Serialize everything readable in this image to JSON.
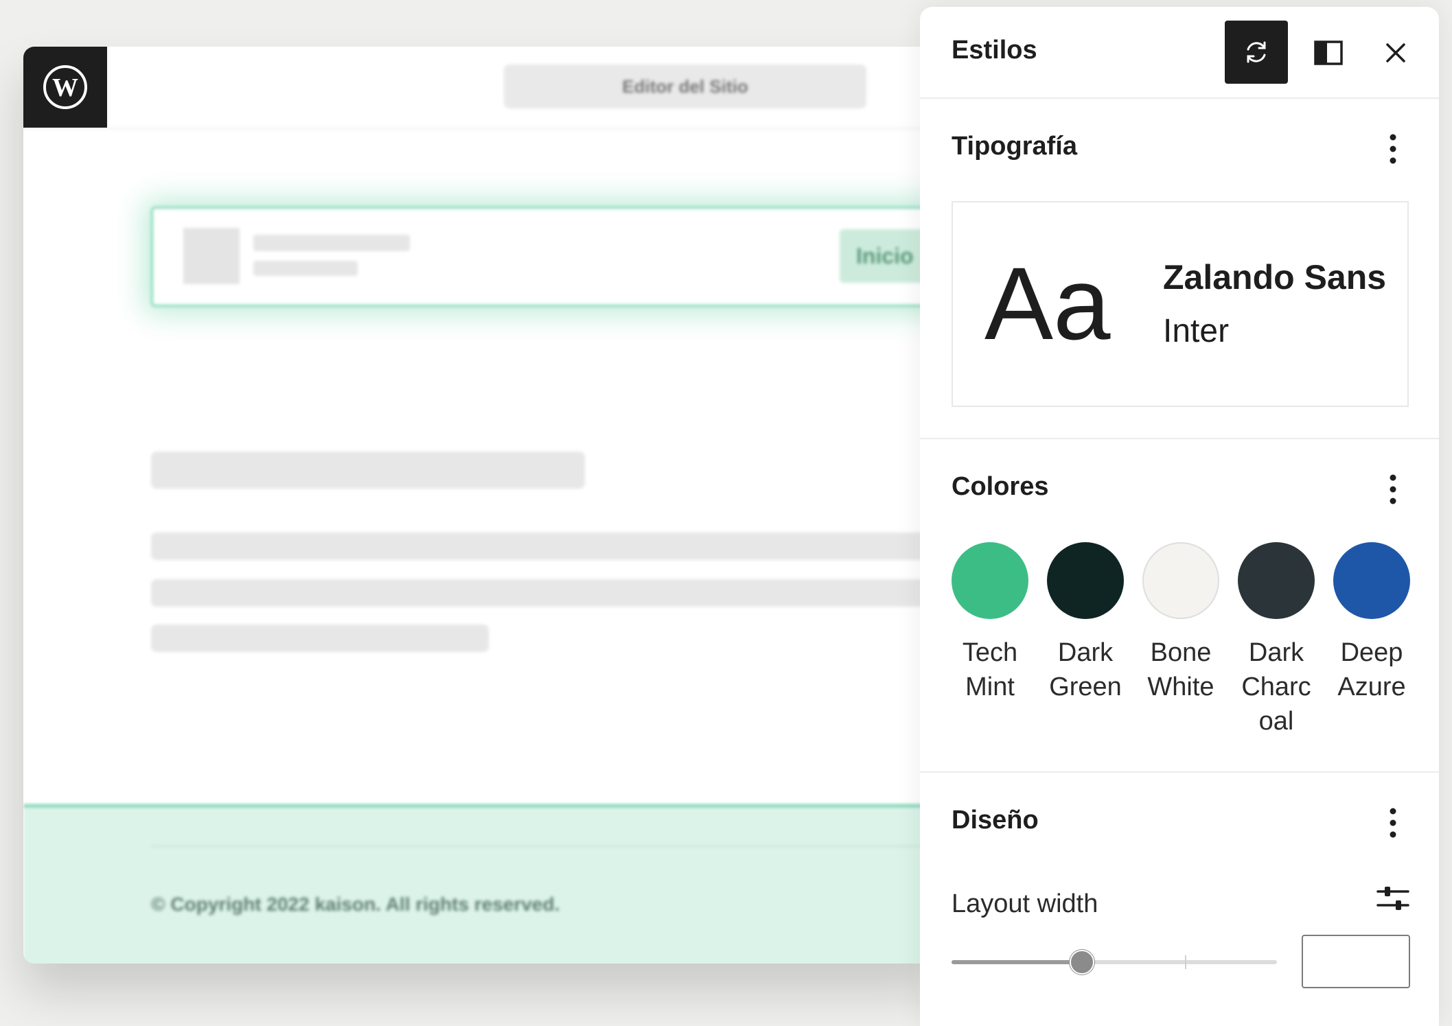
{
  "editor": {
    "site_editor_label": "Editor del Sitio",
    "header_button_label": "Inicio",
    "footer_text": "© Copyright 2022 kaison. All rights reserved."
  },
  "panel": {
    "title": "Estilos",
    "typography": {
      "title": "Tipografía",
      "preview_sample": "Aa",
      "heading_font": "Zalando Sans",
      "body_font": "Inter"
    },
    "colors": {
      "title": "Colores",
      "swatches": [
        {
          "line1": "Tech",
          "line2": "Mint",
          "line3": "",
          "color": "#3dbd86"
        },
        {
          "line1": "Dark",
          "line2": "Green",
          "line3": "",
          "color": "#0f2524"
        },
        {
          "line1": "Bone",
          "line2": "White",
          "line3": "",
          "color": "#f4f3ef"
        },
        {
          "line1": "Dark",
          "line2": "Charc",
          "line3": "oal",
          "color": "#2b3438"
        },
        {
          "line1": "Deep",
          "line2": "Azure",
          "line3": "",
          "color": "#1f57a8"
        }
      ]
    },
    "design": {
      "title": "Diseño",
      "layout_width_label": "Layout width",
      "layout_width_value": "",
      "slider_fraction": 0.4
    },
    "icons": {
      "revisions": "revisions-icon",
      "toggle": "sidebar-toggle-icon",
      "close": "close-icon",
      "more": "more-vertical-icon",
      "settings": "sliders-icon"
    },
    "accent_color": "#1e1e1e"
  }
}
